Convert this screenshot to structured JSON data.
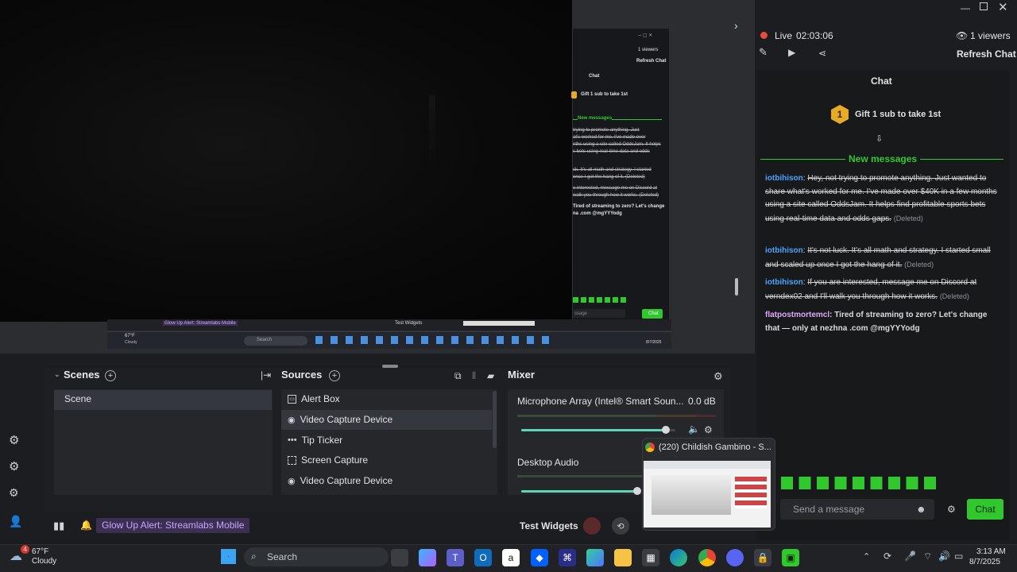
{
  "nested_chat": {
    "viewers": "1 viewers",
    "refresh": "Refresh Chat",
    "title": "Chat",
    "gift": "Gift 1 sub to take 1st",
    "new_messages": "New messages",
    "line1": "trying to promote anything. Just",
    "line2": "at's worked for me. I've made over",
    "line3": "nths using a site called OddsJam. It helps",
    "line4": "s bets using real-time data and odds",
    "line5": "ck. It's all math and strategy. I started",
    "line6": "once I got the hang of it. (Deleted)",
    "line7": "e interested, message me on Discord at",
    "line8": "walk you through how it works. (Deleted)",
    "line9": "Tired of streaming to zero? Let's change",
    "line10": "na .com @mgYYYodg",
    "input": "ssage",
    "chat_btn": "Chat",
    "alert": "Glow Up Alert: Streamlabs Mobile",
    "widgets": "Test Widgets",
    "weather": "67°F",
    "weather2": "Cloudy",
    "search": "Search",
    "time": "8/7/2025"
  },
  "scenes": {
    "title": "Scenes",
    "items": [
      "Scene"
    ]
  },
  "sources": {
    "title": "Sources",
    "items": [
      "Alert Box",
      "Video Capture Device",
      "Tip Ticker",
      "Screen Capture",
      "Video Capture Device"
    ]
  },
  "mixer": {
    "title": "Mixer",
    "mic_name": "Microphone Array (Intel® Smart Soun...",
    "mic_db": "0.0 dB",
    "desktop_name": "Desktop Audio",
    "mic_level": 0.94,
    "desktop_level": 0.97
  },
  "status": {
    "alert": "Glow Up Alert: Streamlabs Mobile",
    "test_widgets": "Test Widgets"
  },
  "chat": {
    "live_label": "Live",
    "live_time": "02:03:06",
    "viewers": "1 viewers",
    "refresh": "Refresh Chat",
    "title": "Chat",
    "gift_rank": "1",
    "gift_text": "Gift 1 sub to take 1st",
    "new_messages": "New messages",
    "messages": [
      {
        "user": "iotbihison",
        "text": "Hey, not trying to promote anything. Just wanted to share what's worked for me. I've made over $40K in a few months using a site called OddsJam. It helps find profitable sports bets using real-time data and odds gaps.",
        "tag": "(Deleted)"
      },
      {
        "user": "iotbihison",
        "text": "It's not luck. It's all math and strategy. I started small and scaled up once I got the hang of it.",
        "tag": "(Deleted)"
      },
      {
        "user": "iotbihison",
        "text": "If you are interested, message me on Discord at verndex02 and I'll walk you through how it works.",
        "tag": "(Deleted)"
      },
      {
        "user": "flatpostmortemcl",
        "text": "Tired of streaming to zero? Let's change that — only at nezhna .com @mgYYYodg",
        "tag": ""
      }
    ],
    "input_placeholder": "Send a message",
    "send": "Chat"
  },
  "popup": {
    "title": "(220) Childish Gambino - S..."
  },
  "taskbar": {
    "weather_temp": "67°F",
    "weather_desc": "Cloudy",
    "weather_badge": "4",
    "search": "Search",
    "time": "3:13 AM",
    "date": "8/7/2025"
  },
  "colors": {
    "accent": "#31c82e",
    "username": "#4aa3ff",
    "live": "#e74c3c"
  }
}
